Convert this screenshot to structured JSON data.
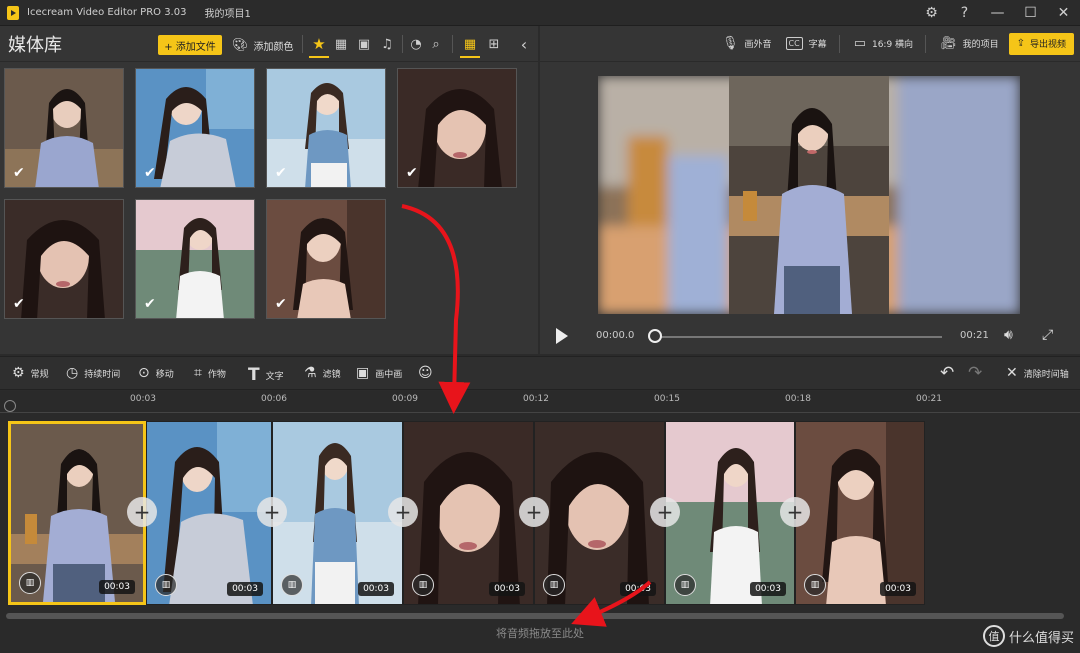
{
  "window": {
    "app_title": "Icecream Video Editor PRO 3.03",
    "project_title": "我的项目1",
    "controls": [
      "⚙",
      "?",
      "—",
      "☐",
      "✕"
    ]
  },
  "media": {
    "title": "媒体库",
    "add_file": "+ 添加文件",
    "add_color": "添加颜色"
  },
  "preview": {
    "voiceover": "画外音",
    "subtitle": "字幕",
    "ratio": "16:9 横向",
    "my_projects": "我的项目",
    "export": "导出视频",
    "time_current": "00:00.0",
    "time_total": "00:21"
  },
  "edit_toolbar": {
    "general": "常规",
    "duration": "持续时间",
    "move": "移动",
    "crop": "作物",
    "text": "文字",
    "filter": "滤镜",
    "pip": "画中画",
    "clear_timeline": "清除时间轴"
  },
  "timeline": {
    "ticks": [
      "00:03",
      "00:06",
      "00:09",
      "00:12",
      "00:15",
      "00:18",
      "00:21"
    ],
    "clips": [
      {
        "duration": "00:03"
      },
      {
        "duration": "00:03"
      },
      {
        "duration": "00:03"
      },
      {
        "duration": "00:03"
      },
      {
        "duration": "00:03"
      },
      {
        "duration": "00:03"
      },
      {
        "duration": "00:03"
      }
    ],
    "audio_hint": "将音频拖放至此处"
  },
  "watermark": "什么值得买",
  "colors": {
    "accent": "#f5c518",
    "arrow": "#e8141b"
  }
}
